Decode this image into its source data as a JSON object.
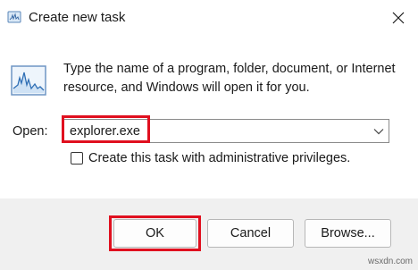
{
  "window": {
    "title": "Create new task",
    "close_icon": "close-icon",
    "app_icon": "run-app-icon"
  },
  "content": {
    "icon": "run-dialog-icon",
    "description": "Type the name of a program, folder, document, or Internet resource, and Windows will open it for you.",
    "open_label": "Open:",
    "open_value": "explorer.exe",
    "admin_checkbox_label": "Create this task with administrative privileges.",
    "admin_checkbox_checked": false
  },
  "buttons": {
    "ok": "OK",
    "cancel": "Cancel",
    "browse": "Browse..."
  },
  "highlight_color": "#e0101f",
  "watermark": "wsxdn.com"
}
